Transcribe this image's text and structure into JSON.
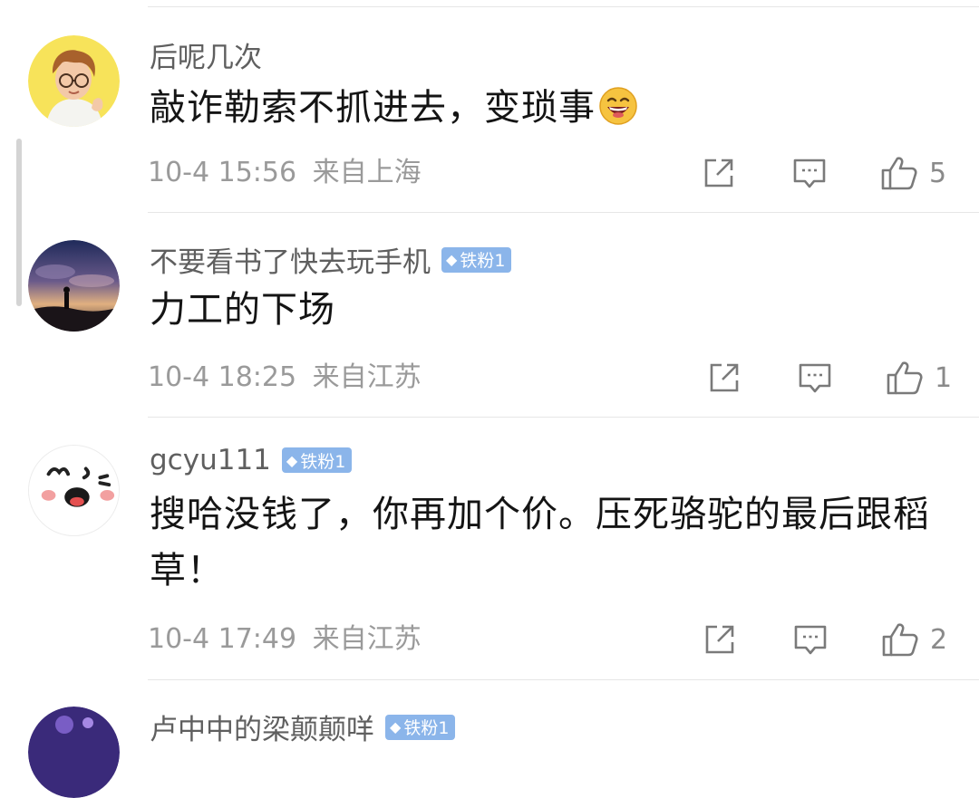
{
  "comments": [
    {
      "username": "后呢几次",
      "badge": "",
      "text": "敲诈勒索不抓进去，变琐事",
      "emoji": "grinning-face",
      "date": "10-4 15:56",
      "location": "来自上海",
      "likes": "5"
    },
    {
      "username": "不要看书了快去玩手机",
      "badge": "铁粉1",
      "text": "力工的下场",
      "date": "10-4 18:25",
      "location": "来自江苏",
      "likes": "1"
    },
    {
      "username": "gcyu111",
      "badge": "铁粉1",
      "text": "搜哈没钱了，你再加个价。压死骆驼的最后跟稻草！",
      "date": "10-4 17:49",
      "location": "来自江苏",
      "likes": "2"
    },
    {
      "username": "卢中中的梁颠颠咩",
      "badge": "铁粉1"
    }
  ],
  "icons": {
    "share": "share-icon",
    "reply": "comment-icon",
    "like": "thumbs-up-icon"
  },
  "colors": {
    "badge": "#8bb5ea",
    "meta": "#9a9a9a",
    "username": "#5f5f5f"
  }
}
